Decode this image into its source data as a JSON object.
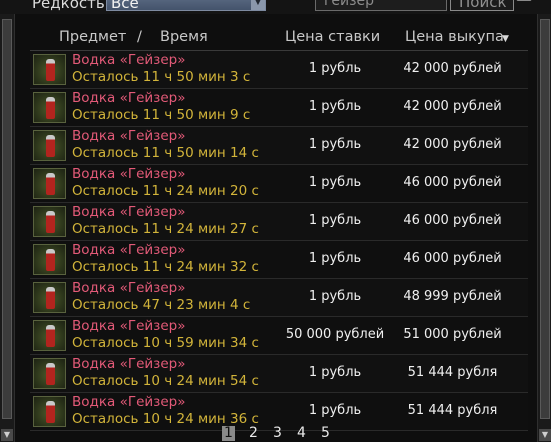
{
  "filter": {
    "rarity_label": "Редкость",
    "rarity_value": "Все",
    "search_value": "гейзер",
    "search_button": "Поиск"
  },
  "table": {
    "headers": {
      "item": "Предмет",
      "separator": "/",
      "time": "Время",
      "bid": "Цена ставки",
      "buyout": "Цена выкупа"
    },
    "rows": [
      {
        "name": "Водка «Гейзер»",
        "time": "Осталось 11 ч 50 мин 3 с",
        "bid": "1 рубль",
        "buyout": "42 000 рублей"
      },
      {
        "name": "Водка «Гейзер»",
        "time": "Осталось 11 ч 50 мин 9 с",
        "bid": "1 рубль",
        "buyout": "42 000 рублей"
      },
      {
        "name": "Водка «Гейзер»",
        "time": "Осталось 11 ч 50 мин 14 с",
        "bid": "1 рубль",
        "buyout": "42 000 рублей"
      },
      {
        "name": "Водка «Гейзер»",
        "time": "Осталось 11 ч 24 мин 20 с",
        "bid": "1 рубль",
        "buyout": "46 000 рублей"
      },
      {
        "name": "Водка «Гейзер»",
        "time": "Осталось 11 ч 24 мин 27 с",
        "bid": "1 рубль",
        "buyout": "46 000 рублей"
      },
      {
        "name": "Водка «Гейзер»",
        "time": "Осталось 11 ч 24 мин 32 с",
        "bid": "1 рубль",
        "buyout": "46 000 рублей"
      },
      {
        "name": "Водка «Гейзер»",
        "time": "Осталось 47 ч 23 мин 4 с",
        "bid": "1 рубль",
        "buyout": "48 999 рублей"
      },
      {
        "name": "Водка «Гейзер»",
        "time": "Осталось 10 ч 59 мин 34 с",
        "bid": "50 000 рублей",
        "buyout": "51 000 рублей"
      },
      {
        "name": "Водка «Гейзер»",
        "time": "Осталось 10 ч 24 мин 54 с",
        "bid": "1 рубль",
        "buyout": "51 444 рубля"
      },
      {
        "name": "Водка «Гейзер»",
        "time": "Осталось 10 ч 24 мин 36 с",
        "bid": "1 рубль",
        "buyout": "51 444 рубля"
      }
    ]
  },
  "pagination": {
    "pages": [
      "1",
      "2",
      "3",
      "4",
      "5"
    ],
    "active": "1"
  },
  "icons": {
    "sort": "sort-descending-icon",
    "thumbnail": "vodka-bottle-icon",
    "scroll_down": "scroll-down-arrow-icon",
    "dropdown": "chevron-down-icon"
  },
  "colors": {
    "item_name": "#e35a78",
    "time_left": "#d2b43a",
    "background": "#0e0e0e",
    "active_page": "#8a8a8a"
  }
}
